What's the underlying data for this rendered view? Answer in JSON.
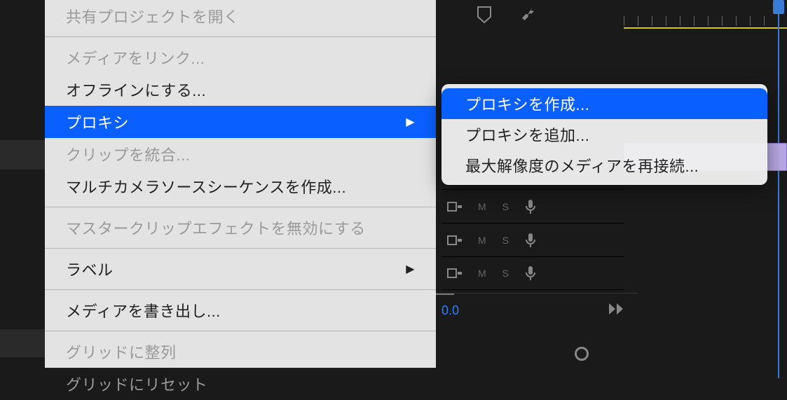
{
  "menu": {
    "open_shared_project": "共有プロジェクトを開く",
    "link_media": "メディアをリンク...",
    "make_offline": "オフラインにする...",
    "proxy": "プロキシ",
    "merge_clips": "クリップを統合...",
    "create_multicam": "マルチカメラソースシーケンスを作成...",
    "disable_master_clip_fx": "マスタークリップエフェクトを無効にする",
    "label": "ラベル",
    "export_media": "メディアを書き出し...",
    "align_to_grid": "グリッドに整列",
    "reset_to_grid": "グリッドにリセット"
  },
  "submenu": {
    "create_proxy": "プロキシを作成...",
    "append_proxy": "プロキシを追加...",
    "reconnect_full_res": "最大解像度のメディアを再接続..."
  },
  "tracks": {
    "mute": "M",
    "solo": "S"
  },
  "audio": {
    "level": "0.0"
  },
  "arrow": "▶"
}
